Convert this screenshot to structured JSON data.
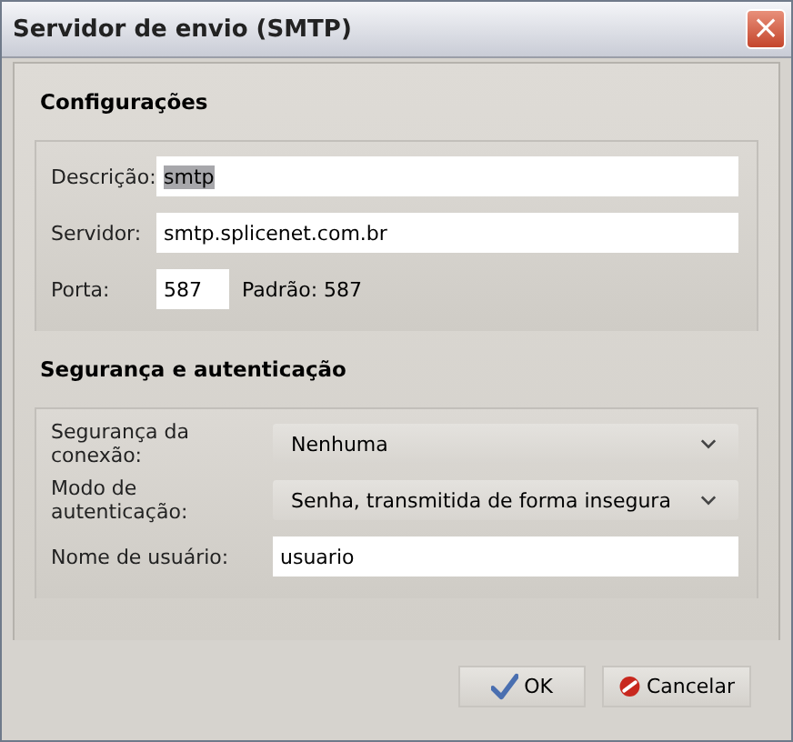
{
  "window": {
    "title": "Servidor de envio (SMTP)",
    "close": "×"
  },
  "sections": [
    {
      "title": "Configurações",
      "rows": [
        {
          "kind": "text",
          "label": "Descrição:",
          "value": "smtp",
          "highlighted": true
        },
        {
          "kind": "text",
          "label": "Servidor:",
          "value": "smtp.splicenet.com.br",
          "highlighted": false
        },
        {
          "kind": "short",
          "label": "Porta:",
          "value": "587",
          "note": "Padrão: 587",
          "highlighted": false
        }
      ]
    },
    {
      "title": "Segurança e autenticação",
      "rows": [
        {
          "kind": "select",
          "label": "Segurança da conexão:",
          "value": "Nenhuma"
        },
        {
          "kind": "select",
          "label": "Modo de autenticação:",
          "value": "Senha, transmitida de forma insegura"
        },
        {
          "kind": "text",
          "label": "Nome de usuário:",
          "value": "usuario",
          "highlighted": false
        }
      ]
    }
  ],
  "buttons": [
    {
      "kind": "ok",
      "label": "OK"
    },
    {
      "kind": "cancel",
      "label": "Cancelar"
    }
  ]
}
